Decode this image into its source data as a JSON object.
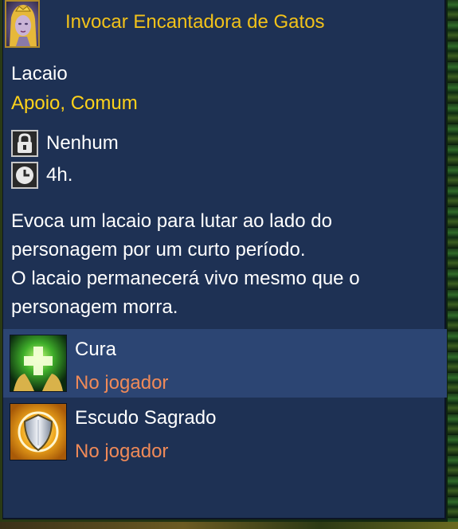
{
  "tooltip": {
    "title": "Invocar Encantadora de Gatos",
    "unit_type": "Lacaio",
    "tags": "Apoio, Comum",
    "requirement": {
      "icon": "lock-icon",
      "value": "Nenhum"
    },
    "duration": {
      "icon": "clock-icon",
      "value": "4h."
    },
    "description": [
      "Evoca um lacaio para lutar ao lado do",
      "personagem por um curto período.",
      "O lacaio permanecerá vivo mesmo que o",
      "personagem morra."
    ],
    "abilities": [
      {
        "name": "Cura",
        "target": "No jogador",
        "icon": "healing-hands-icon",
        "highlighted": true
      },
      {
        "name": "Escudo Sagrado",
        "target": "No jogador",
        "icon": "holy-shield-icon",
        "highlighted": false
      }
    ]
  },
  "colors": {
    "panel_bg": "#1e3154",
    "title": "#f2c21a",
    "tags": "#ffd21a",
    "target": "#f08a58",
    "highlight_row": "#2c4573"
  }
}
